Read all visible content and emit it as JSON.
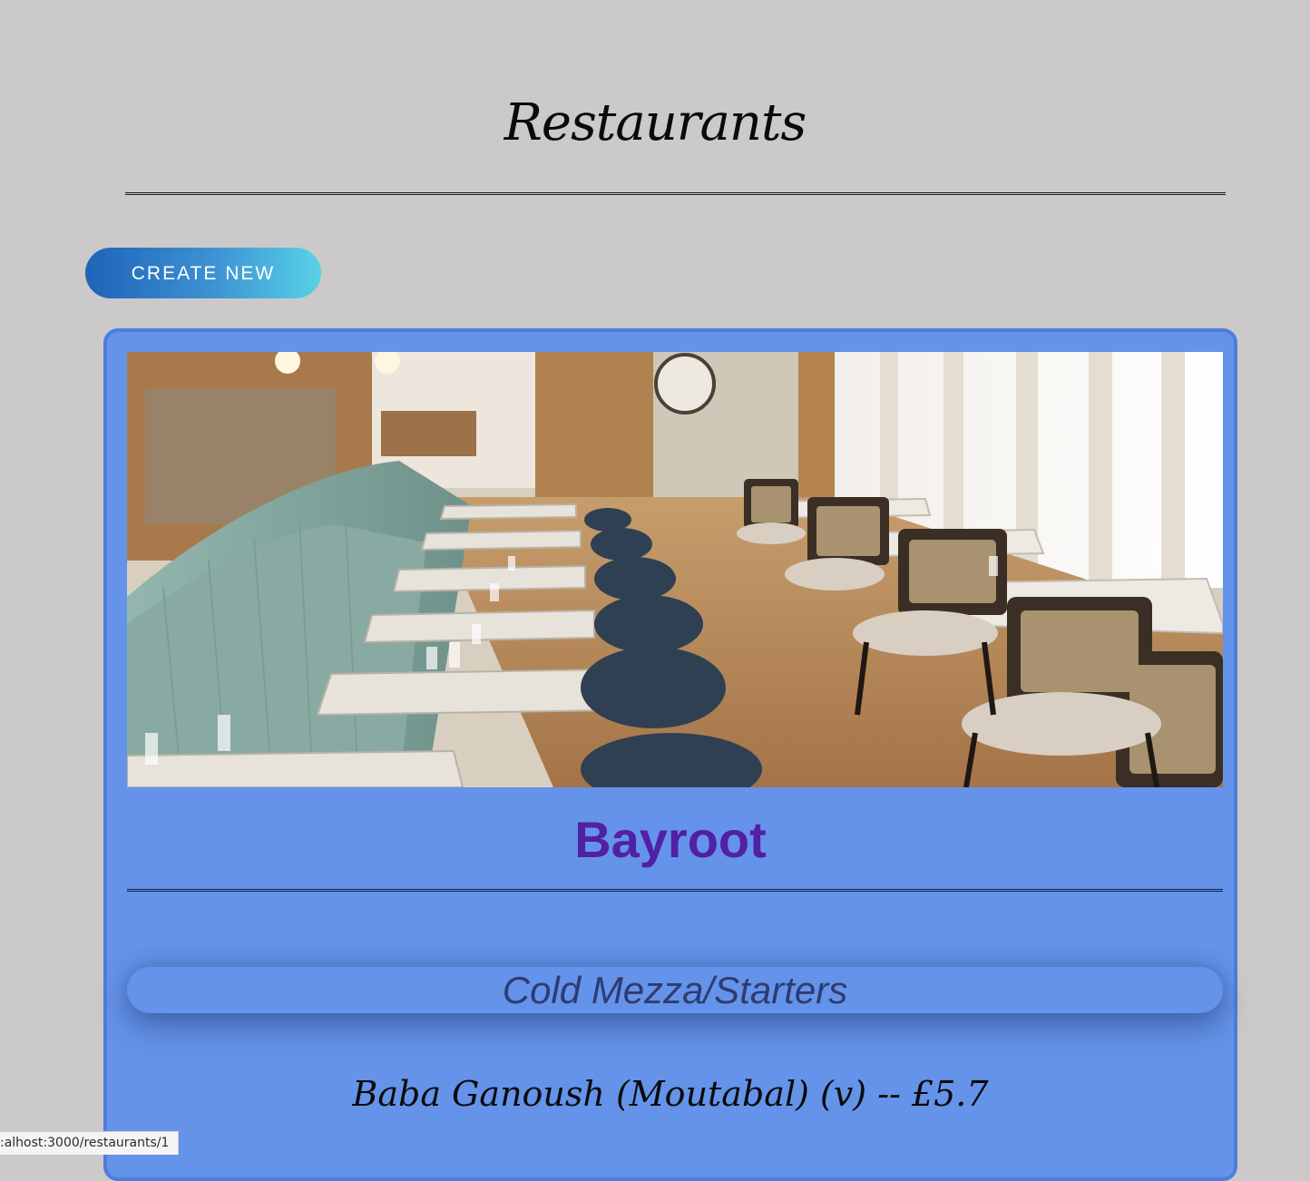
{
  "page": {
    "title": "Restaurants"
  },
  "actions": {
    "create_label": "CREATE NEW"
  },
  "restaurant": {
    "name": "Bayroot",
    "photo_icon": "restaurant-interior-photo",
    "category": "Cold Mezza/Starters",
    "item": "Baba Ganoush (Moutabal) (v) -- £5.7"
  },
  "status_bar": {
    "url": ":alhost:3000/restaurants/1"
  },
  "colors": {
    "background": "#cbc9ca",
    "card": "#6493e9",
    "card_border": "#4e7edc",
    "restaurant_name": "#5120a3",
    "category_text": "#2e3c72",
    "button_gradient_start": "#1f63b8",
    "button_gradient_end": "#58d2e6"
  }
}
